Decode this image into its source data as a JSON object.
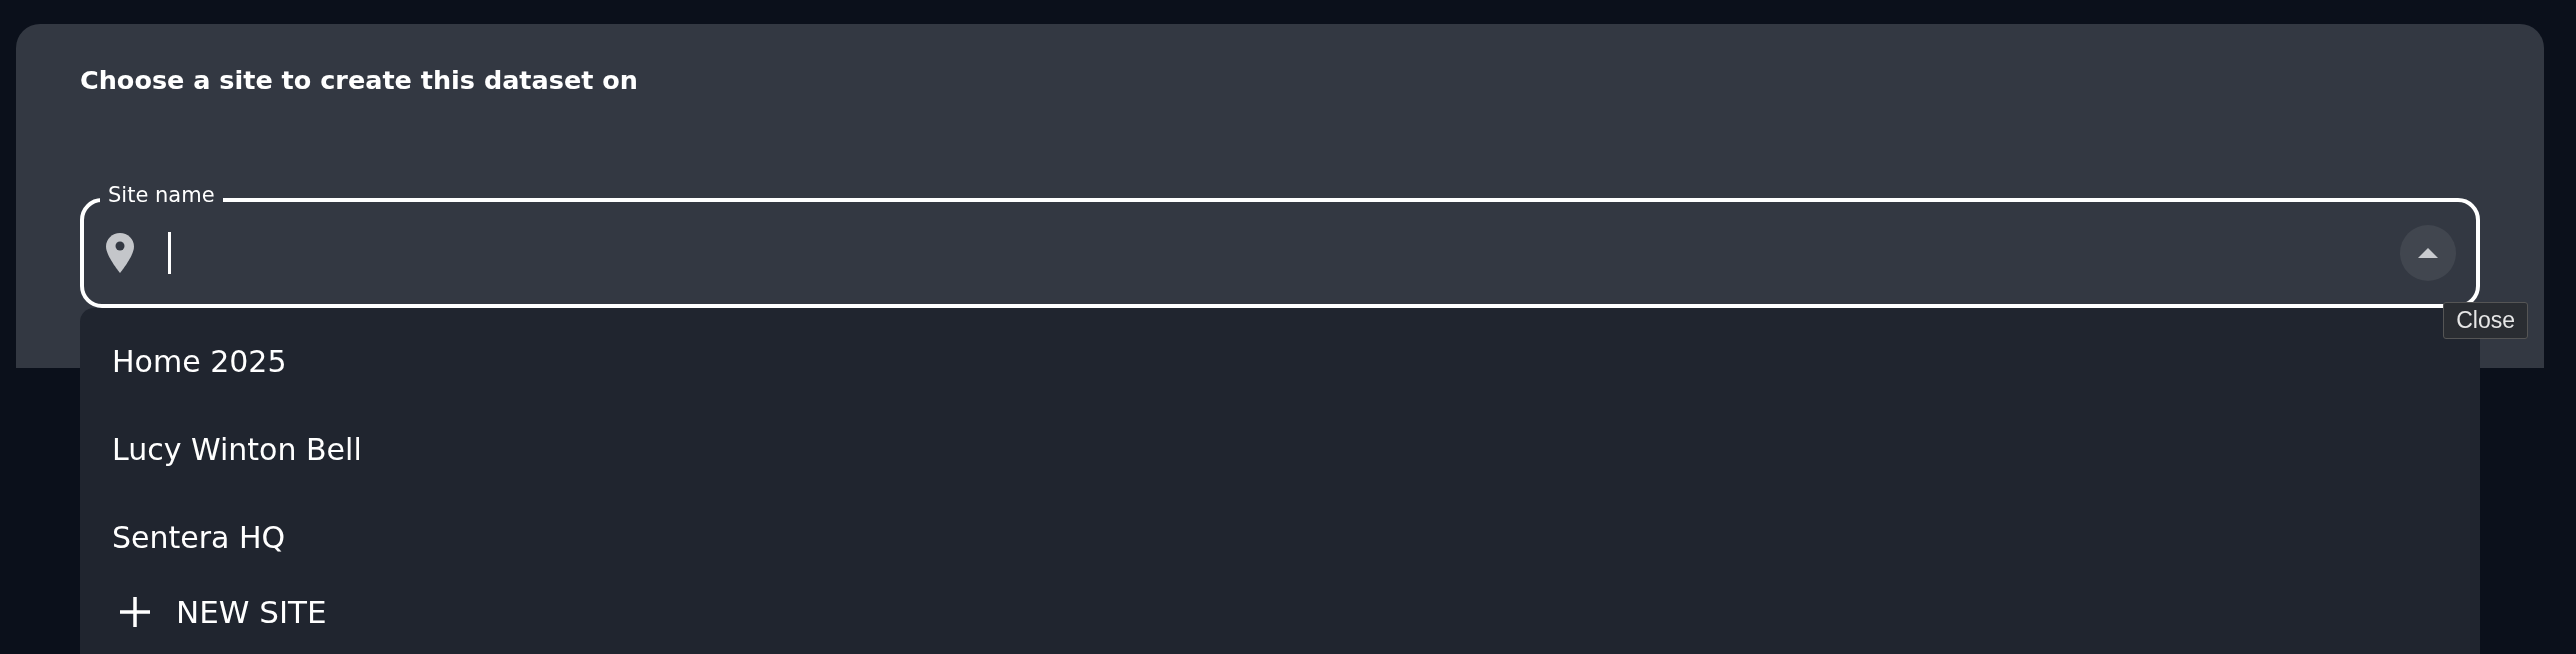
{
  "dialog": {
    "title": "Choose a site to create this dataset on"
  },
  "site_field": {
    "label": "Site name",
    "focused": true,
    "expanded": true,
    "toggle_tooltip": "Close"
  },
  "options": [
    {
      "label": "Home 2025",
      "kind": "option"
    },
    {
      "label": "Lucy Winton Bell",
      "kind": "option"
    },
    {
      "label": "Sentera HQ",
      "kind": "option"
    },
    {
      "label": "NEW SITE",
      "kind": "action"
    }
  ]
}
